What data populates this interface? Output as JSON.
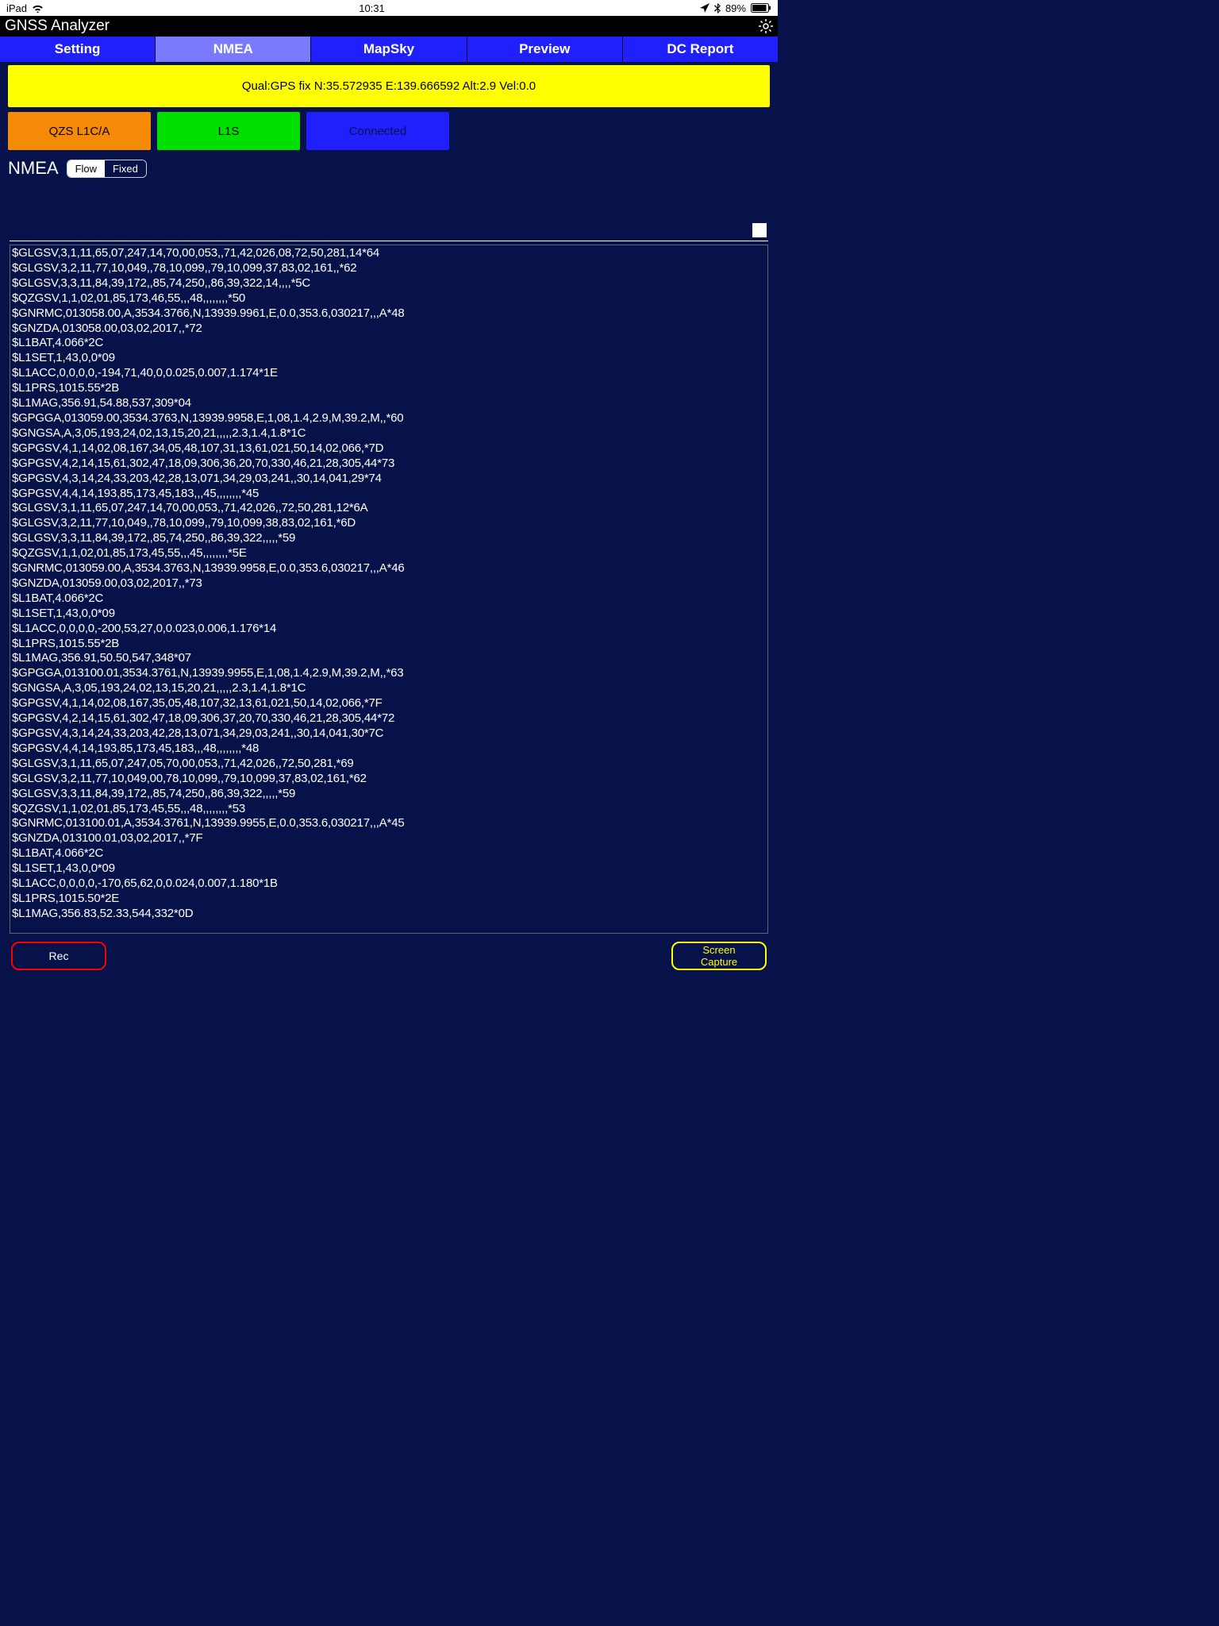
{
  "status": {
    "device": "iPad",
    "time": "10:31",
    "battery": "89%"
  },
  "app": {
    "title": "GNSS Analyzer"
  },
  "tabs": [
    "Setting",
    "NMEA",
    "MapSky",
    "Preview",
    "DC Report"
  ],
  "active_tab": "NMEA",
  "qual": "Qual:GPS fix N:35.572935 E:139.666592 Alt:2.9 Vel:0.0",
  "pills": {
    "qzs": "QZS L1C/A",
    "l1s": "L1S",
    "conn": "Connected"
  },
  "section": {
    "label": "NMEA",
    "seg_on": "Flow",
    "seg_off": "Fixed"
  },
  "footer": {
    "rec": "Rec",
    "cap1": "Screen",
    "cap2": "Capture"
  },
  "log": [
    "$GLGSV,3,1,11,65,07,247,14,70,00,053,,71,42,026,08,72,50,281,14*64",
    "$GLGSV,3,2,11,77,10,049,,78,10,099,,79,10,099,37,83,02,161,,*62",
    "$GLGSV,3,3,11,84,39,172,,85,74,250,,86,39,322,14,,,,*5C",
    "$QZGSV,1,1,02,01,85,173,46,55,,,48,,,,,,,,*50",
    "$GNRMC,013058.00,A,3534.3766,N,13939.9961,E,0.0,353.6,030217,,,A*48",
    "$GNZDA,013058.00,03,02,2017,,*72",
    "$L1BAT,4.066*2C",
    "$L1SET,1,43,0,0*09",
    "$L1ACC,0,0,0,0,-194,71,40,0,0.025,0.007,1.174*1E",
    "$L1PRS,1015.55*2B",
    "$L1MAG,356.91,54.88,537,309*04",
    "$GPGGA,013059.00,3534.3763,N,13939.9958,E,1,08,1.4,2.9,M,39.2,M,,*60",
    "$GNGSA,A,3,05,193,24,02,13,15,20,21,,,,,2.3,1.4,1.8*1C",
    "$GPGSV,4,1,14,02,08,167,34,05,48,107,31,13,61,021,50,14,02,066,*7D",
    "$GPGSV,4,2,14,15,61,302,47,18,09,306,36,20,70,330,46,21,28,305,44*73",
    "$GPGSV,4,3,14,24,33,203,42,28,13,071,34,29,03,241,,30,14,041,29*74",
    "$GPGSV,4,4,14,193,85,173,45,183,,,45,,,,,,,,*45",
    "$GLGSV,3,1,11,65,07,247,14,70,00,053,,71,42,026,,72,50,281,12*6A",
    "$GLGSV,3,2,11,77,10,049,,78,10,099,,79,10,099,38,83,02,161,*6D",
    "$GLGSV,3,3,11,84,39,172,,85,74,250,,86,39,322,,,,,*59",
    "$QZGSV,1,1,02,01,85,173,45,55,,,45,,,,,,,,*5E",
    "$GNRMC,013059.00,A,3534.3763,N,13939.9958,E,0.0,353.6,030217,,,A*46",
    "$GNZDA,013059.00,03,02,2017,,*73",
    "$L1BAT,4.066*2C",
    "$L1SET,1,43,0,0*09",
    "$L1ACC,0,0,0,0,-200,53,27,0,0.023,0.006,1.176*14",
    "$L1PRS,1015.55*2B",
    "$L1MAG,356.91,50.50,547,348*07",
    "$GPGGA,013100.01,3534.3761,N,13939.9955,E,1,08,1.4,2.9,M,39.2,M,,*63",
    "$GNGSA,A,3,05,193,24,02,13,15,20,21,,,,,2.3,1.4,1.8*1C",
    "$GPGSV,4,1,14,02,08,167,35,05,48,107,32,13,61,021,50,14,02,066,*7F",
    "$GPGSV,4,2,14,15,61,302,47,18,09,306,37,20,70,330,46,21,28,305,44*72",
    "$GPGSV,4,3,14,24,33,203,42,28,13,071,34,29,03,241,,30,14,041,30*7C",
    "$GPGSV,4,4,14,193,85,173,45,183,,,48,,,,,,,,*48",
    "$GLGSV,3,1,11,65,07,247,05,70,00,053,,71,42,026,,72,50,281,*69",
    "$GLGSV,3,2,11,77,10,049,00,78,10,099,,79,10,099,37,83,02,161,*62",
    "$GLGSV,3,3,11,84,39,172,,85,74,250,,86,39,322,,,,,*59",
    "$QZGSV,1,1,02,01,85,173,45,55,,,48,,,,,,,,*53",
    "$GNRMC,013100.01,A,3534.3761,N,13939.9955,E,0.0,353.6,030217,,,A*45",
    "$GNZDA,013100.01,03,02,2017,,*7F",
    "$L1BAT,4.066*2C",
    "$L1SET,1,43,0,0*09",
    "$L1ACC,0,0,0,0,-170,65,62,0,0.024,0.007,1.180*1B",
    "$L1PRS,1015.50*2E",
    "$L1MAG,356.83,52.33,544,332*0D"
  ]
}
